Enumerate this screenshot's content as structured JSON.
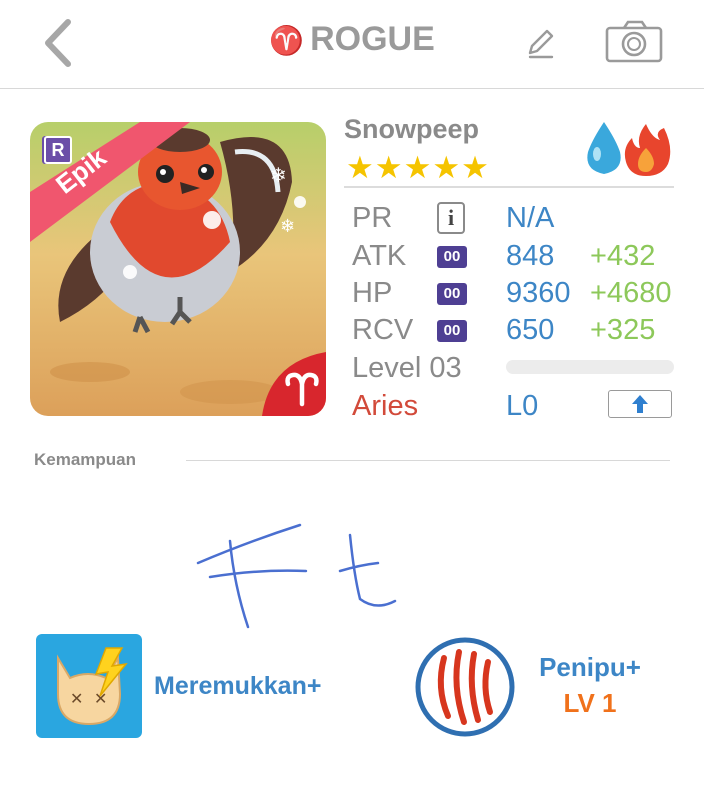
{
  "header": {
    "title_sign": "♈",
    "title": "ROGUE",
    "icons": {
      "back": "back-chevron-icon",
      "edit": "pencil-icon",
      "camera": "camera-icon"
    }
  },
  "card": {
    "rarity_label": "Epik",
    "rarity_badge": "R",
    "zodiac_badge_icon": "aries-sign-icon",
    "colors": {
      "ribbon": "#f0566e",
      "badge_bg": "#6b4ea8",
      "zodiac_bg": "#d8262d"
    }
  },
  "monster": {
    "name": "Snowpeep",
    "stars": "★★★★★",
    "elements": [
      "water-drop-icon",
      "fire-icon"
    ]
  },
  "stats": {
    "pr": {
      "label": "PR",
      "value": "N/A"
    },
    "atk": {
      "label": "ATK",
      "badge": "00",
      "value": "848",
      "bonus": "+432"
    },
    "hp": {
      "label": "HP",
      "badge": "00",
      "value": "9360",
      "bonus": "+4680"
    },
    "rcv": {
      "label": "RCV",
      "badge": "00",
      "value": "650",
      "bonus": "+325"
    },
    "level": {
      "label": "Level 03",
      "progress": 0
    },
    "sign": {
      "label": "Aries",
      "value": "L0"
    }
  },
  "abilities": {
    "title": "Kemampuan",
    "skill1": {
      "name": "Meremukkan+",
      "icon": "lightning-face-icon"
    },
    "skill2": {
      "name": "Penipu+",
      "level": "LV 1",
      "icon": "claw-marks-icon"
    }
  },
  "colors": {
    "accent_blue": "#3d86c6",
    "bonus_green": "#8dc85a",
    "aries_red": "#d24a3a",
    "star_yellow": "#f5c400",
    "level_orange": "#f0711b"
  }
}
